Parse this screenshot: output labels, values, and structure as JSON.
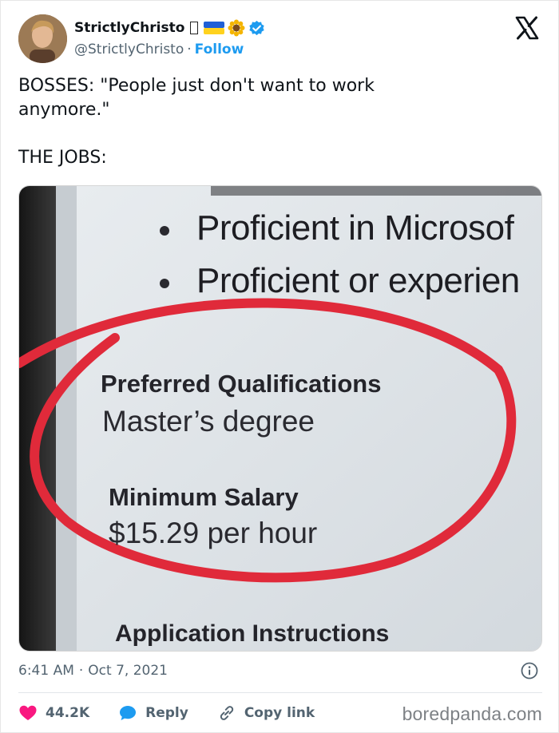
{
  "author": {
    "display_name": "StrictlyChristo",
    "handle": "@StrictlyChristo",
    "separator": "·",
    "follow_label": "Follow"
  },
  "tweet": {
    "line1": "BOSSES: \"People just don't want to work",
    "line2": "anymore.\"",
    "line3": "THE JOBS:"
  },
  "photo": {
    "bullet1": "Proficient in Microsof",
    "bullet2": "Proficient or experien",
    "heading1": "Preferred Qualifications",
    "value1": "Master’s degree",
    "heading2": "Minimum Salary",
    "value2": "$15.29 per hour",
    "heading3": "Application Instructions",
    "circle_color": "#e02a3a"
  },
  "meta": {
    "time": "6:41 AM",
    "separator": "·",
    "date": "Oct 7, 2021"
  },
  "actions": {
    "likes": "44.2K",
    "reply_label": "Reply",
    "copy_label": "Copy link"
  },
  "watermark": "boredpanda.com",
  "colors": {
    "accent": "#1d9bf0",
    "like": "#f91880",
    "muted": "#536471"
  }
}
